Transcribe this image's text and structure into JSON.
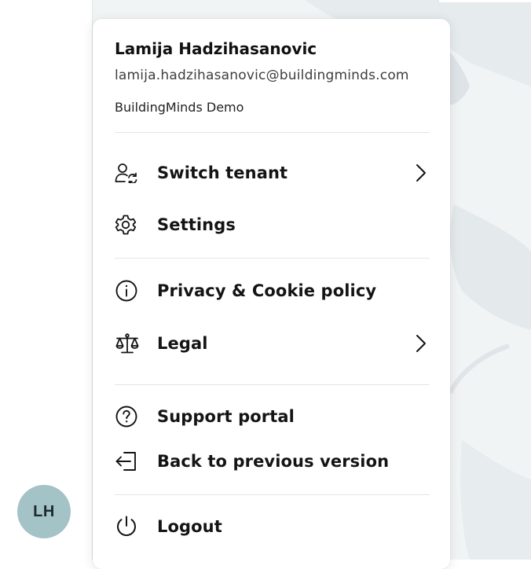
{
  "user": {
    "name": "Lamija Hadzihasanovic",
    "email": "lamija.hadzihasanovic@buildingminds.com",
    "tenant": "BuildingMinds Demo",
    "initials": "LH"
  },
  "menu": {
    "switch_tenant": {
      "label": "Switch tenant",
      "icon": "switch-tenant-icon"
    },
    "settings": {
      "label": "Settings",
      "icon": "gear-icon"
    },
    "privacy": {
      "label": "Privacy & Cookie policy",
      "icon": "info-icon"
    },
    "legal": {
      "label": "Legal",
      "icon": "scale-icon"
    },
    "support": {
      "label": "Support portal",
      "icon": "question-icon"
    },
    "back": {
      "label": "Back to previous version",
      "icon": "exit-arrow-icon"
    },
    "logout": {
      "label": "Logout",
      "icon": "power-icon"
    }
  },
  "colors": {
    "avatar_bg": "#a4c3c6",
    "divider": "#e3e5e6",
    "map_bg": "#f1f4f5"
  }
}
